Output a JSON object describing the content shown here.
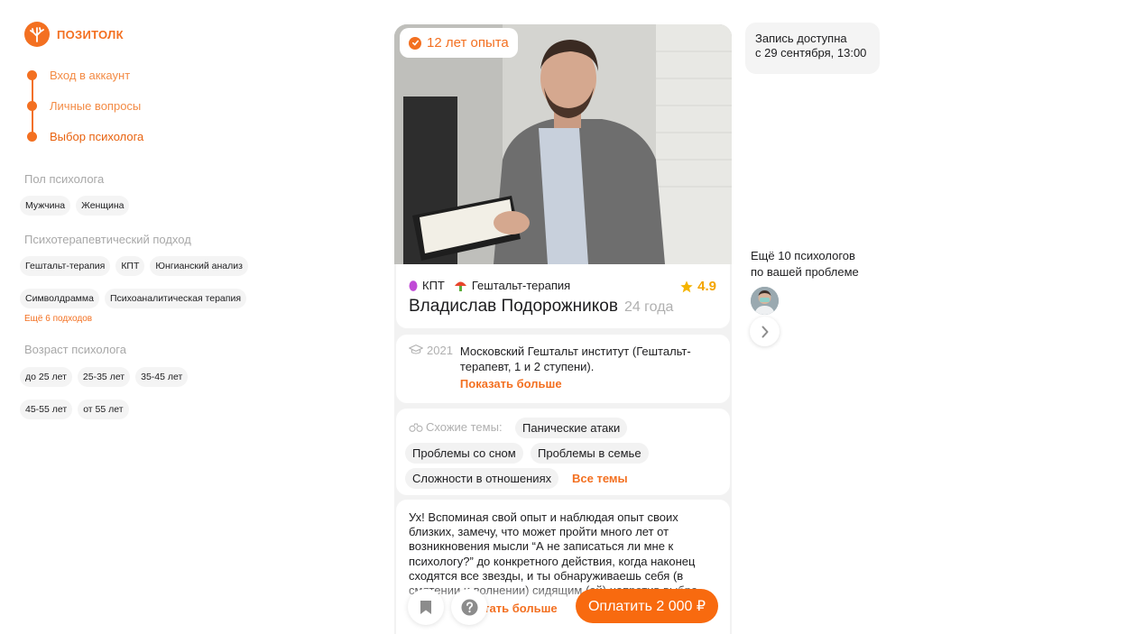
{
  "brand": {
    "name": "позитолк",
    "color": "#f37021"
  },
  "steps": [
    {
      "label": "Вход в аккаунт",
      "active": false
    },
    {
      "label": "Личные вопросы",
      "active": false
    },
    {
      "label": "Выбор психолога",
      "active": true
    }
  ],
  "filters": {
    "gender": {
      "title": "Пол психолога",
      "options": [
        "Мужчина",
        "Женщина"
      ]
    },
    "approach": {
      "title": "Психотерапевтический подход",
      "options_row1": [
        "Гештальт-терапия",
        "КПТ",
        "Юнгианский анализ"
      ],
      "options_row2": [
        "Символдрамма",
        "Психоаналитическая терапия"
      ],
      "more": "Ещё 6 подходов"
    },
    "age": {
      "title": "Возраст психолога",
      "options_row1": [
        "до 25 лет",
        "25-35 лет",
        "35-45 лет"
      ],
      "options_row2": [
        "45-55 лет",
        "от 55 лет"
      ]
    }
  },
  "card": {
    "experience_badge": "12 лет опыта",
    "methods": [
      {
        "label": "КПТ",
        "icon": "purple-egg-icon"
      },
      {
        "label": "Гештальт-терапия",
        "icon": "mushroom-icon"
      }
    ],
    "rating": "4.9",
    "name": "Владислав Подорожников",
    "age": "24 года",
    "education": {
      "year": "2021",
      "text": "Московский Гештальт институт (Гештальт-терапевт, 1 и 2 ступени).",
      "more": "Показать больше"
    },
    "topics": {
      "label": "Схожие темы:",
      "items": [
        "Панические атаки",
        "Проблемы со сном",
        "Проблемы в семье",
        "Сложности в отношениях"
      ],
      "all": "Все темы"
    },
    "description": "Ух! Вспоминая свой опыт и наблюдая опыт своих близких, замечу, что может пройти много лет от возникновения мысли “А не записаться ли мне к психологу?” до конкретного действия, когда наконец сходятся все звезды, и ты обнаруживаешь себя (в смятении и волнении) сидящим (ей) напротив выбра...",
    "description_more": "Читать больше",
    "pay_button": "Оплатить 2 000 ₽"
  },
  "booking": {
    "line1": "Запись доступна",
    "line2": "с 29 сентября, 13:00"
  },
  "more_psychologists": {
    "line1": "Ещё 10 психологов",
    "line2": "по вашей проблеме"
  }
}
